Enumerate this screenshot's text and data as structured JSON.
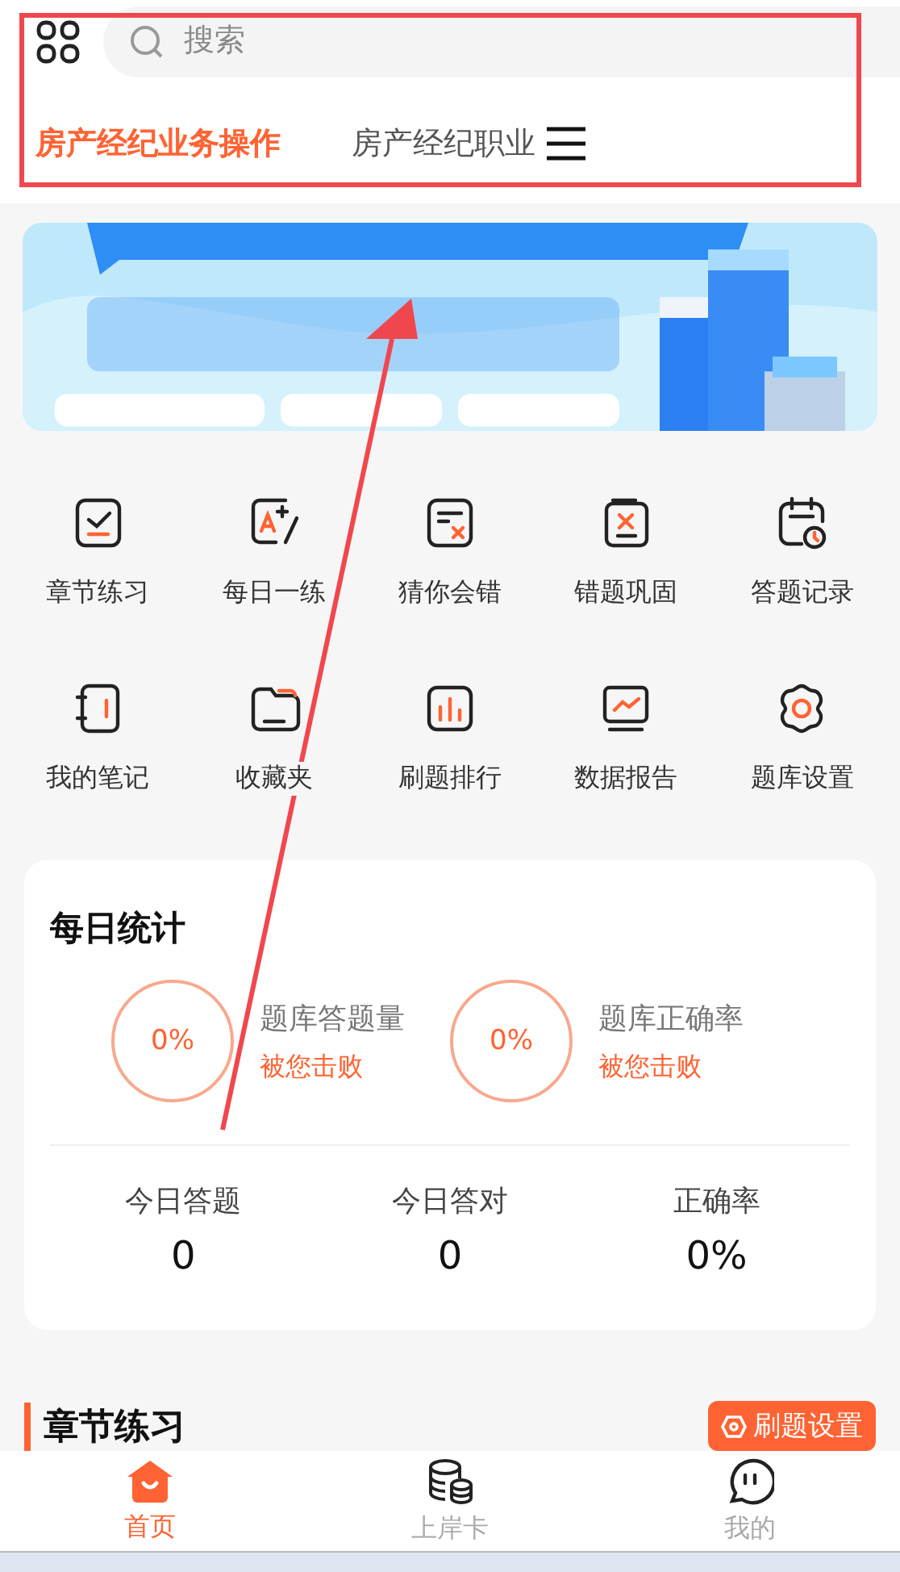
{
  "search": {
    "placeholder": "搜索"
  },
  "subject_tabs": [
    {
      "label": "房产经纪业务操作",
      "selected": true
    },
    {
      "label": "房产经纪职业",
      "selected": false
    }
  ],
  "features": [
    {
      "label": "章节练习"
    },
    {
      "label": "每日一练"
    },
    {
      "label": "猜你会错"
    },
    {
      "label": "错题巩固"
    },
    {
      "label": "答题记录"
    },
    {
      "label": "我的笔记"
    },
    {
      "label": "收藏夹"
    },
    {
      "label": "刷题排行"
    },
    {
      "label": "数据报告"
    },
    {
      "label": "题库设置"
    }
  ],
  "daily_stats": {
    "title": "每日统计",
    "rings": [
      {
        "value": "0%",
        "label": "题库答题量",
        "note": "被您击败"
      },
      {
        "value": "0%",
        "label": "题库正确率",
        "note": "被您击败"
      }
    ],
    "totals": [
      {
        "label": "今日答题",
        "value": "0"
      },
      {
        "label": "今日答对",
        "value": "0"
      },
      {
        "label": "正确率",
        "value": "0%"
      }
    ]
  },
  "section": {
    "title": "章节练习",
    "action": "刷题设置"
  },
  "tab_bar": [
    {
      "label": "首页",
      "selected": true
    },
    {
      "label": "上岸卡",
      "selected": false
    },
    {
      "label": "我的",
      "selected": false
    }
  ]
}
